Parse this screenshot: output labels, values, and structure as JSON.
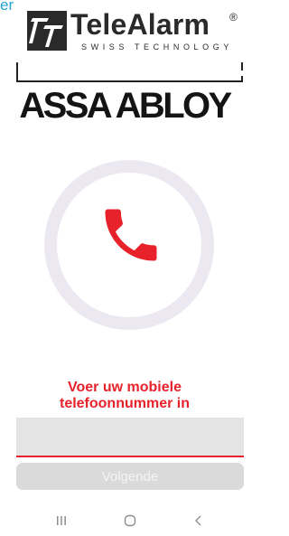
{
  "header": {
    "top_link_text": "er",
    "brand_name": "TeleAlarm",
    "brand_registered": "®",
    "brand_tagline": "SWISS TECHNOLOGY",
    "partner_logo_text": "ASSA ABLOY"
  },
  "call": {
    "icon": "phone-handset-icon",
    "ring_color": "#ece8f1",
    "icon_color": "#e8222b"
  },
  "form": {
    "prompt_line1": "Voer uw mobiele",
    "prompt_line2": "telefoonnummer in",
    "phone_value": "",
    "next_label": "Volgende"
  },
  "navbar": {
    "recents_icon": "recent-apps-icon",
    "home_icon": "home-icon",
    "back_icon": "back-icon"
  },
  "colors": {
    "accent": "#e8222b",
    "link": "#25a6d4",
    "field_bg": "#e4e4e4",
    "button_disabled_bg": "#dadada"
  }
}
